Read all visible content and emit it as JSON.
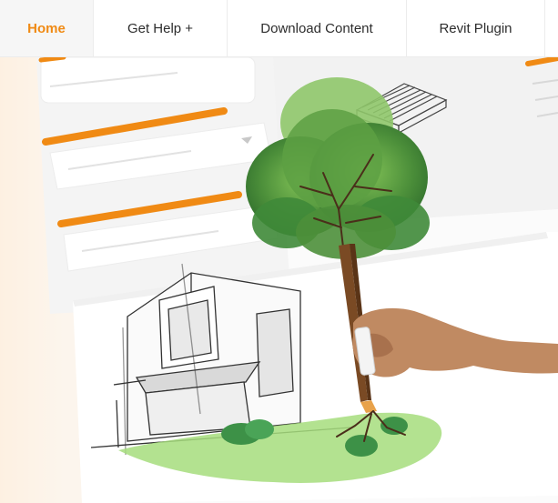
{
  "nav": {
    "items": [
      {
        "label": "Home",
        "active": true
      },
      {
        "label": "Get Help +",
        "active": false
      },
      {
        "label": "Download Content",
        "active": false
      },
      {
        "label": "Revit Plugin",
        "active": false
      }
    ]
  },
  "colors": {
    "accent": "#f08a14",
    "nav_text": "#2d2d2d",
    "foliage": "#4c8f3a",
    "grass": "#8fcf6a"
  },
  "hero": {
    "icons": [
      "form-card-icon",
      "dropdown-chevron-icon",
      "lumber-stack-icon",
      "tree-icon",
      "house-sketch-icon",
      "hand-icon"
    ]
  }
}
